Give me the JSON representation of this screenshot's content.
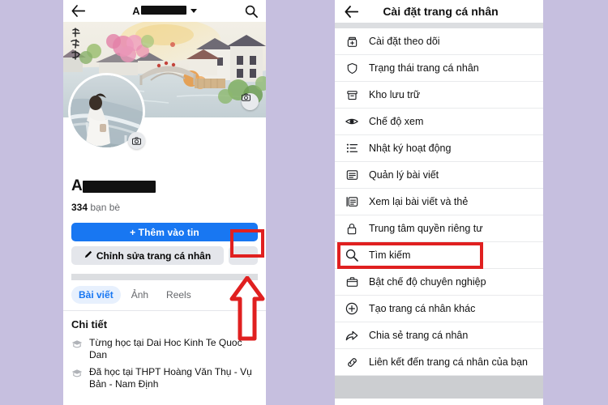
{
  "theme": {
    "page_background": "#c6bfdf",
    "facebook_blue": "#1877f2",
    "highlight_red": "#e02020",
    "panel_white": "#ffffff",
    "gray_divider": "#dcdee1",
    "secondary_button": "#e4e6eb",
    "muted_text": "#65676b"
  },
  "left_panel": {
    "topbar": {
      "back_icon": "back-arrow-icon",
      "profile_name": "A",
      "profile_name_redacted": true,
      "dropdown_icon": "chevron-down-icon",
      "search_icon": "search-icon"
    },
    "cover": {
      "camera_icon": "camera-icon",
      "description": "watercolor painting of a Chinese water town with arched stone bridge"
    },
    "avatar": {
      "camera_icon": "camera-icon",
      "description": "person standing at a bridge railing"
    },
    "profile": {
      "name_initial": "A",
      "name_redacted": true,
      "friends_count": "334",
      "friends_label": "bạn bè"
    },
    "buttons": {
      "add_to_story": "+ Thêm vào tin",
      "edit_profile": "Chỉnh sửa trang cá nhân",
      "edit_profile_icon": "pencil-icon",
      "more_options": "•••",
      "more_options_highlighted": true
    },
    "tabs": [
      {
        "label": "Bài viết",
        "active": true
      },
      {
        "label": "Ảnh",
        "active": false
      },
      {
        "label": "Reels",
        "active": false
      }
    ],
    "details": {
      "title": "Chi tiết",
      "items": [
        {
          "icon": "graduation-cap-icon",
          "text": "Từng học tại Dai Hoc Kinh Te Quoc Dan"
        },
        {
          "icon": "graduation-cap-icon",
          "text": "Đã học tại THPT Hoàng Văn Thụ - Vụ Bản - Nam Định"
        }
      ]
    },
    "annotation": {
      "arrow": "red-up-arrow",
      "points_at": "more-options-button"
    }
  },
  "right_panel": {
    "topbar": {
      "back_icon": "back-arrow-icon",
      "title": "Cài đặt trang cá nhân"
    },
    "menu_items": [
      {
        "icon": "follow-settings-icon",
        "label": "Cài đặt theo dõi",
        "highlighted": false
      },
      {
        "icon": "shield-icon",
        "label": "Trạng thái trang cá nhân",
        "highlighted": false
      },
      {
        "icon": "archive-icon",
        "label": "Kho lưu trữ",
        "highlighted": false
      },
      {
        "icon": "eye-icon",
        "label": "Chế độ xem",
        "highlighted": false
      },
      {
        "icon": "activity-log-icon",
        "label": "Nhật ký hoạt động",
        "highlighted": false
      },
      {
        "icon": "manage-posts-icon",
        "label": "Quản lý bài viết",
        "highlighted": false
      },
      {
        "icon": "review-posts-icon",
        "label": "Xem lại bài viết và thẻ",
        "highlighted": false
      },
      {
        "icon": "lock-icon",
        "label": "Trung tâm quyền riêng tư",
        "highlighted": false
      },
      {
        "icon": "search-icon",
        "label": "Tìm kiếm",
        "highlighted": true
      },
      {
        "icon": "briefcase-icon",
        "label": "Bật chế độ chuyên nghiệp",
        "highlighted": false
      },
      {
        "icon": "plus-circle-icon",
        "label": "Tạo trang cá nhân khác",
        "highlighted": false
      },
      {
        "icon": "share-arrow-icon",
        "label": "Chia sẻ trang cá nhân",
        "highlighted": false
      },
      {
        "icon": "link-icon",
        "label": "Liên kết đến trang cá nhân của bạn",
        "highlighted": false
      }
    ]
  }
}
